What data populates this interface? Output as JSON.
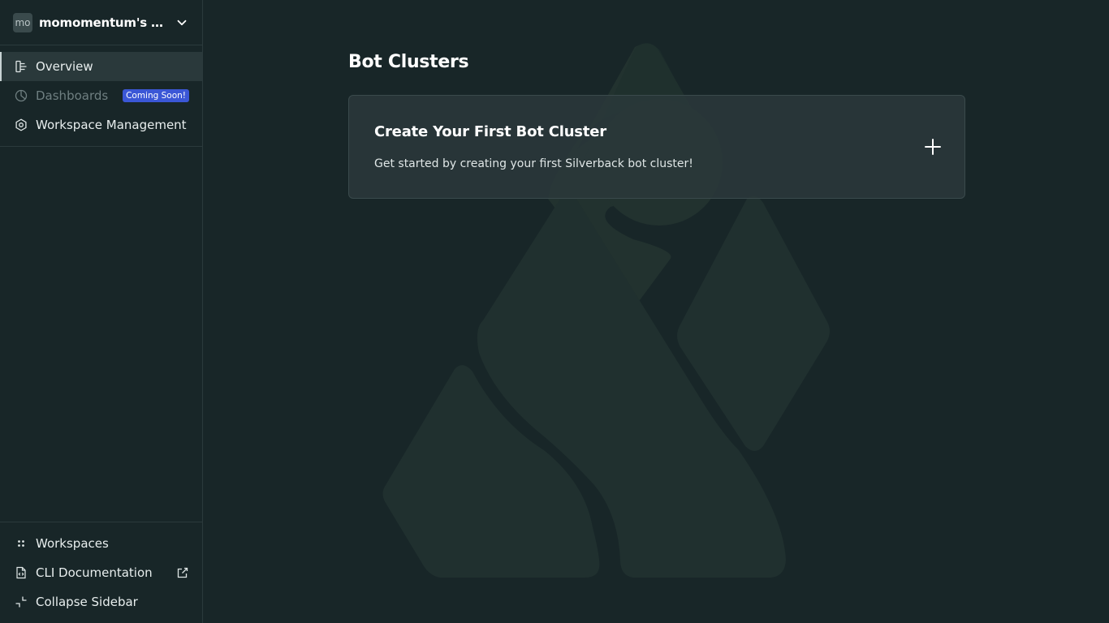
{
  "workspace": {
    "avatar_text": "mo",
    "name": "momomentum's Wor..."
  },
  "sidebar": {
    "top_items": [
      {
        "label": "Overview",
        "icon": "overview-icon",
        "state": "active"
      },
      {
        "label": "Dashboards",
        "icon": "pie-chart-icon",
        "state": "disabled",
        "badge": "Coming Soon!"
      },
      {
        "label": "Workspace Management",
        "icon": "hexagon-gear-icon",
        "state": "normal"
      }
    ],
    "bottom_items": [
      {
        "label": "Workspaces",
        "icon": "grid-dots-icon"
      },
      {
        "label": "CLI Documentation",
        "icon": "code-file-icon",
        "external": true
      },
      {
        "label": "Collapse Sidebar",
        "icon": "collapse-icon"
      }
    ]
  },
  "main": {
    "title": "Bot Clusters",
    "card": {
      "title": "Create Your First Bot Cluster",
      "description": "Get started by creating your first Silverback bot cluster!"
    }
  },
  "colors": {
    "background": "#182628",
    "sidebar_active": "#2a393b",
    "badge": "#3b57d6",
    "card": "#2a383a",
    "logo_watermark": "#20302f"
  }
}
